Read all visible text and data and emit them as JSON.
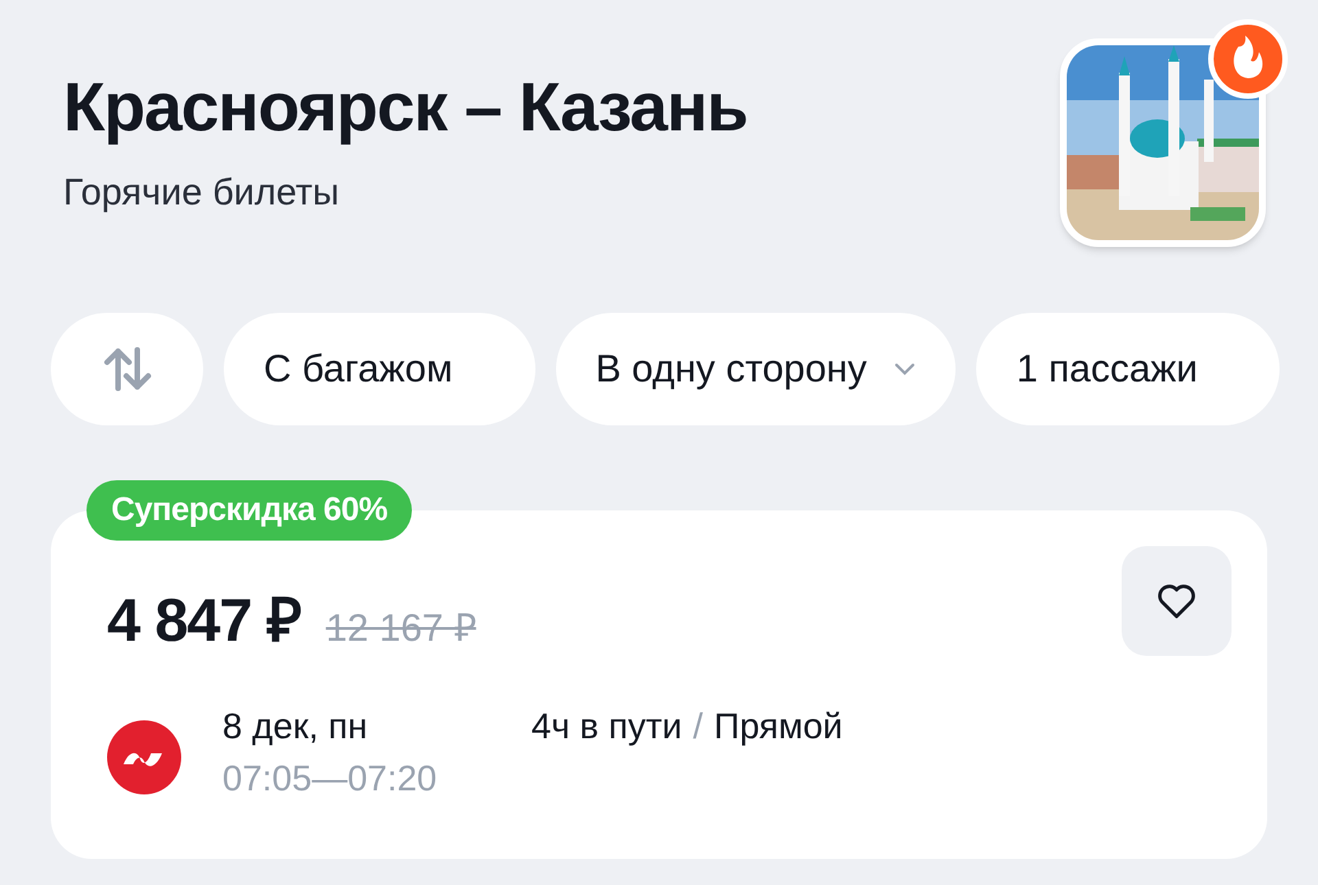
{
  "header": {
    "title": "Красноярск – Казань",
    "subtitle": "Горячие билеты"
  },
  "filters": [
    {
      "kind": "swap"
    },
    {
      "kind": "chip",
      "label": "С багажом"
    },
    {
      "kind": "dropdown",
      "label": "В одну сторону"
    },
    {
      "kind": "chip",
      "label": "1 пассажи"
    }
  ],
  "offer": {
    "badge": "Суперскидка 60%",
    "price": "4 847 ₽",
    "old_price": "12 167 ₽",
    "flight": {
      "date": "8 дек, пн",
      "times": "07:05—07:20",
      "duration": "4ч в пути",
      "separator": "/",
      "type": "Прямой"
    }
  }
}
